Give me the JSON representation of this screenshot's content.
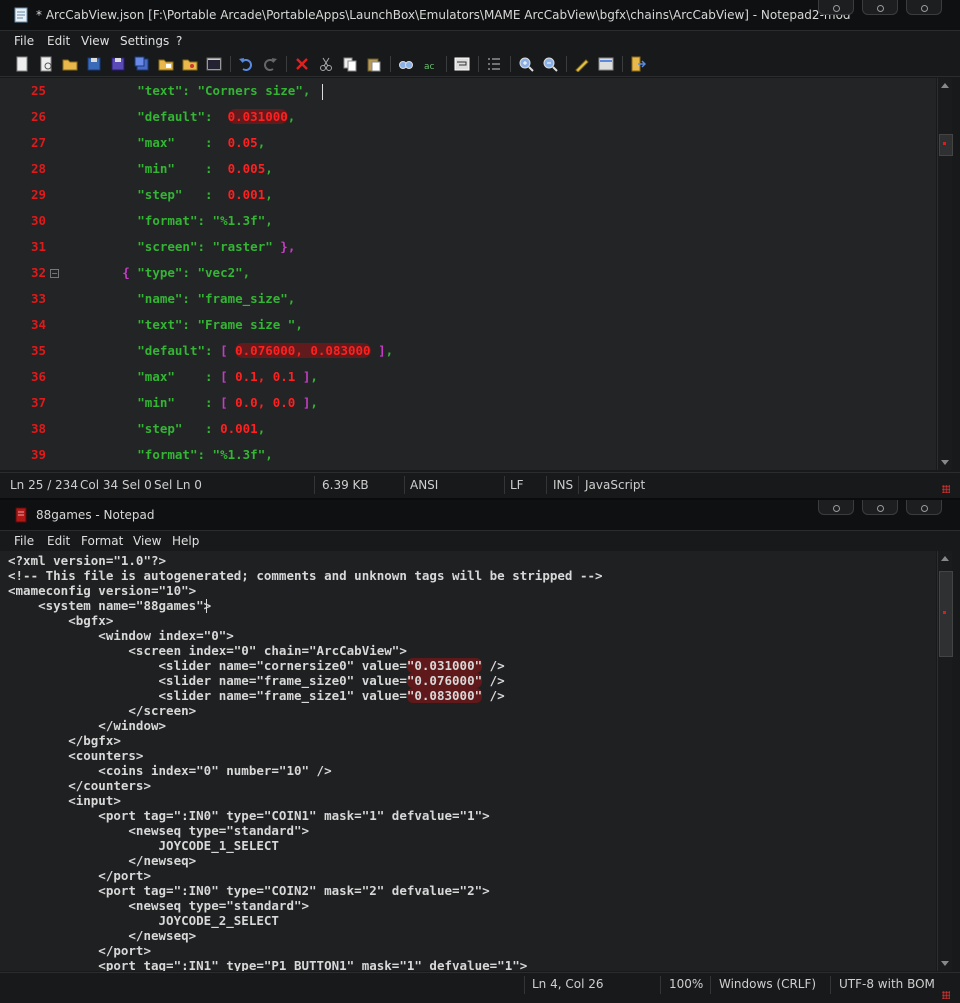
{
  "window1": {
    "title": "* ArcCabView.json [F:\\Portable Arcade\\PortableApps\\LaunchBox\\Emulators\\MAME ArcCabView\\bgfx\\chains\\ArcCabView] - Notepad2-mod",
    "menu": [
      "File",
      "Edit",
      "View",
      "Settings",
      "?"
    ],
    "toolbar_icons": [
      "new-icon",
      "open-icon",
      "open-folder-icon",
      "save-icon",
      "save-as-icon",
      "save-copy-icon",
      "browse-icon",
      "favorites-icon",
      "run-icon",
      "undo-icon",
      "redo-icon",
      "delete-icon",
      "cut-icon",
      "copy-icon",
      "paste-icon",
      "find-icon",
      "replace-icon",
      "word-wrap-icon",
      "line-numbers-icon",
      "zoom-in-icon",
      "zoom-out-icon",
      "scheme-icon",
      "customize-icon",
      "exit-icon"
    ],
    "lines": [
      {
        "num": "25",
        "indent": "          ",
        "tokens": [
          {
            "t": "\"text\"",
            "c": "k"
          },
          {
            "t": ": ",
            "c": "s"
          },
          {
            "t": "\"Corners size\"",
            "c": "s"
          },
          {
            "t": ",",
            "c": "s"
          }
        ]
      },
      {
        "num": "26",
        "indent": "          ",
        "tokens": [
          {
            "t": "\"default\"",
            "c": "k"
          },
          {
            "t": ":  ",
            "c": "s"
          },
          {
            "t": "0.031000",
            "c": "n",
            "hl": true
          },
          {
            "t": ",",
            "c": "s"
          }
        ]
      },
      {
        "num": "27",
        "indent": "          ",
        "tokens": [
          {
            "t": "\"max\"",
            "c": "k"
          },
          {
            "t": "    :  ",
            "c": "s"
          },
          {
            "t": "0.05",
            "c": "n"
          },
          {
            "t": ",",
            "c": "s"
          }
        ]
      },
      {
        "num": "28",
        "indent": "          ",
        "tokens": [
          {
            "t": "\"min\"",
            "c": "k"
          },
          {
            "t": "    :  ",
            "c": "s"
          },
          {
            "t": "0.005",
            "c": "n"
          },
          {
            "t": ",",
            "c": "s"
          }
        ]
      },
      {
        "num": "29",
        "indent": "          ",
        "tokens": [
          {
            "t": "\"step\"",
            "c": "k"
          },
          {
            "t": "   :  ",
            "c": "s"
          },
          {
            "t": "0.001",
            "c": "n"
          },
          {
            "t": ",",
            "c": "s"
          }
        ]
      },
      {
        "num": "30",
        "indent": "          ",
        "tokens": [
          {
            "t": "\"format\"",
            "c": "k"
          },
          {
            "t": ": ",
            "c": "s"
          },
          {
            "t": "\"%1.3f\"",
            "c": "s"
          },
          {
            "t": ",",
            "c": "s"
          }
        ]
      },
      {
        "num": "31",
        "indent": "          ",
        "tokens": [
          {
            "t": "\"screen\"",
            "c": "k"
          },
          {
            "t": ": ",
            "c": "s"
          },
          {
            "t": "\"raster\"",
            "c": "s"
          },
          {
            "t": " },",
            "c": "b"
          }
        ]
      },
      {
        "num": "32",
        "indent": "        ",
        "fold": true,
        "tokens": [
          {
            "t": "{ ",
            "c": "b"
          },
          {
            "t": "\"type\"",
            "c": "k"
          },
          {
            "t": ": ",
            "c": "s"
          },
          {
            "t": "\"vec2\"",
            "c": "s"
          },
          {
            "t": ",",
            "c": "s"
          }
        ]
      },
      {
        "num": "33",
        "indent": "          ",
        "tokens": [
          {
            "t": "\"name\"",
            "c": "k"
          },
          {
            "t": ": ",
            "c": "s"
          },
          {
            "t": "\"frame_size\"",
            "c": "s"
          },
          {
            "t": ",",
            "c": "s"
          }
        ]
      },
      {
        "num": "34",
        "indent": "          ",
        "tokens": [
          {
            "t": "\"text\"",
            "c": "k"
          },
          {
            "t": ": ",
            "c": "s"
          },
          {
            "t": "\"Frame size \"",
            "c": "s"
          },
          {
            "t": ",",
            "c": "s"
          }
        ]
      },
      {
        "num": "35",
        "indent": "          ",
        "tokens": [
          {
            "t": "\"default\"",
            "c": "k"
          },
          {
            "t": ": ",
            "c": "s"
          },
          {
            "t": "[ ",
            "c": "b"
          },
          {
            "t": "0.076000, 0.083000",
            "c": "n",
            "hl": true
          },
          {
            "t": " ]",
            "c": "b"
          },
          {
            "t": ",",
            "c": "s"
          }
        ]
      },
      {
        "num": "36",
        "indent": "          ",
        "tokens": [
          {
            "t": "\"max\"",
            "c": "k"
          },
          {
            "t": "    : ",
            "c": "s"
          },
          {
            "t": "[ ",
            "c": "b"
          },
          {
            "t": "0.1, 0.1",
            "c": "n"
          },
          {
            "t": " ]",
            "c": "b"
          },
          {
            "t": ",",
            "c": "s"
          }
        ]
      },
      {
        "num": "37",
        "indent": "          ",
        "tokens": [
          {
            "t": "\"min\"",
            "c": "k"
          },
          {
            "t": "    : ",
            "c": "s"
          },
          {
            "t": "[ ",
            "c": "b"
          },
          {
            "t": "0.0, 0.0",
            "c": "n"
          },
          {
            "t": " ]",
            "c": "b"
          },
          {
            "t": ",",
            "c": "s"
          }
        ]
      },
      {
        "num": "38",
        "indent": "          ",
        "tokens": [
          {
            "t": "\"step\"",
            "c": "k"
          },
          {
            "t": "   : ",
            "c": "s"
          },
          {
            "t": "0.001",
            "c": "n"
          },
          {
            "t": ",",
            "c": "s"
          }
        ]
      },
      {
        "num": "39",
        "indent": "          ",
        "tokens": [
          {
            "t": "\"format\"",
            "c": "k"
          },
          {
            "t": ": ",
            "c": "s"
          },
          {
            "t": "\"%1.3f\"",
            "c": "s"
          },
          {
            "t": ",",
            "c": "s"
          }
        ]
      }
    ],
    "status": {
      "position": "Ln 25 / 234",
      "col": "Col 34",
      "sel": "Sel 0",
      "sel_ln": "Sel Ln 0",
      "size": "6.39 KB",
      "encoding": "ANSI",
      "eol": "LF",
      "mode": "INS",
      "lexer": "JavaScript"
    }
  },
  "window2": {
    "title": "88games - Notepad",
    "menu": [
      "File",
      "Edit",
      "Format",
      "View",
      "Help"
    ],
    "lines": [
      "<?xml version=\"1.0\"?>",
      "<!-- This file is autogenerated; comments and unknown tags will be stripped -->",
      "<mameconfig version=\"10\">",
      "    <system name=\"88games\">",
      "        <bgfx>",
      "            <window index=\"0\">",
      "                <screen index=\"0\" chain=\"ArcCabView\">",
      "                    <slider name=\"cornersize0\" value=\"0.031000\" />",
      "                    <slider name=\"frame_size0\" value=\"0.076000\" />",
      "                    <slider name=\"frame_size1\" value=\"0.083000\" />",
      "                </screen>",
      "            </window>",
      "        </bgfx>",
      "        <counters>",
      "            <coins index=\"0\" number=\"10\" />",
      "        </counters>",
      "        <input>",
      "            <port tag=\":IN0\" type=\"COIN1\" mask=\"1\" defvalue=\"1\">",
      "                <newseq type=\"standard\">",
      "                    JOYCODE_1_SELECT",
      "                </newseq>",
      "            </port>",
      "            <port tag=\":IN0\" type=\"COIN2\" mask=\"2\" defvalue=\"2\">",
      "                <newseq type=\"standard\">",
      "                    JOYCODE_2_SELECT",
      "                </newseq>",
      "            </port>",
      "            <port tag=\":IN1\" type=\"P1_BUTTON1\" mask=\"1\" defvalue=\"1\">"
    ],
    "status": {
      "position": "Ln 4, Col 26",
      "zoom": "100%",
      "eol": "Windows (CRLF)",
      "encoding": "UTF-8 with BOM"
    }
  },
  "colors": {
    "line_number": "#e01a1a",
    "key": "#34b534",
    "number": "#ff2020",
    "bracket": "#c43ec4",
    "highlight": "#961414"
  }
}
